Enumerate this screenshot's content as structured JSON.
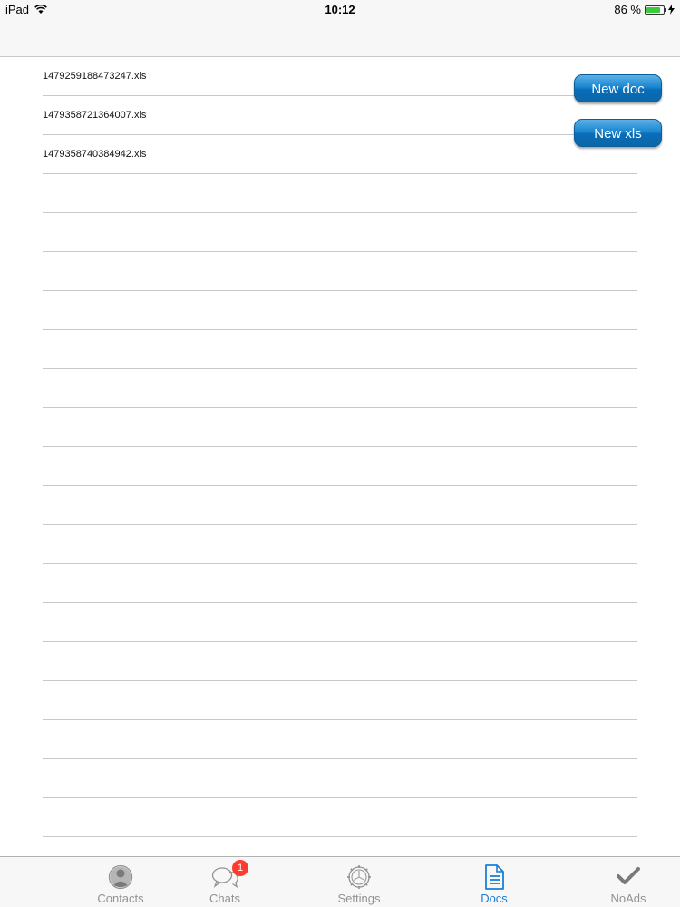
{
  "status_bar": {
    "device": "iPad",
    "time": "10:12",
    "battery": "86 %",
    "battery_level": 0.86
  },
  "docs": {
    "files": [
      "1479259188473247.xls",
      "1479358721364007.xls",
      "1479358740384942.xls",
      "",
      "",
      "",
      "",
      "",
      "",
      "",
      "",
      "",
      "",
      "",
      "",
      "",
      "",
      "",
      "",
      ""
    ],
    "new_doc_label": "New doc",
    "new_xls_label": "New xls"
  },
  "tab_bar": {
    "tabs": [
      {
        "label": "Contacts",
        "icon": "contacts-icon"
      },
      {
        "label": "Chats",
        "icon": "chats-icon",
        "badge": "1"
      },
      {
        "label": "Settings",
        "icon": "settings-icon"
      },
      {
        "label": "Docs",
        "icon": "docs-icon",
        "active": true
      },
      {
        "label": "NoAds",
        "icon": "checkmark-icon"
      }
    ]
  },
  "colors": {
    "accent": "#1a7fd4",
    "inactive": "#929292",
    "badge": "#ff3b30",
    "button": "#1a86cf"
  }
}
